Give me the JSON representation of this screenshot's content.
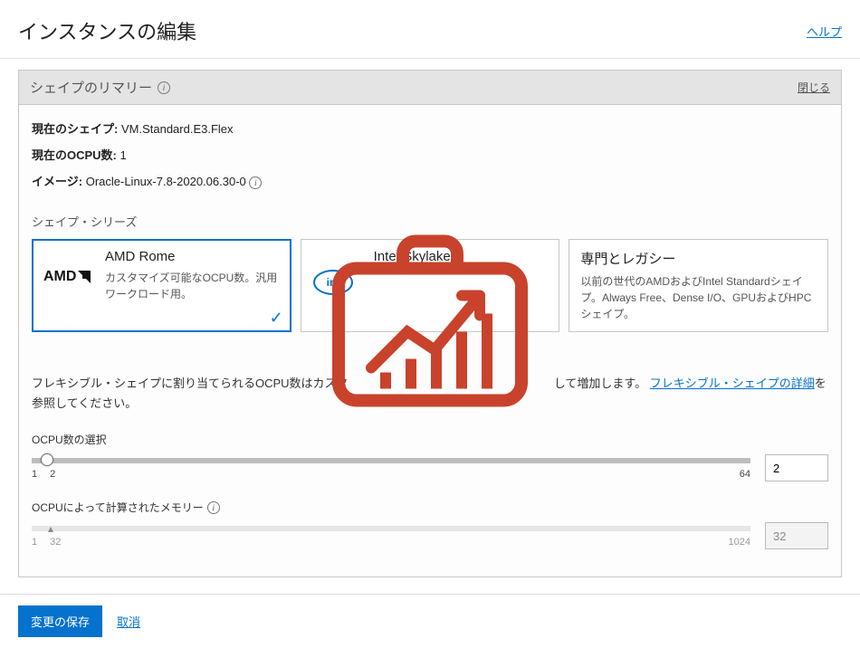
{
  "header": {
    "title": "インスタンスの編集",
    "help": "ヘルプ"
  },
  "panel": {
    "title": "シェイプのリマリー",
    "close": "閉じる"
  },
  "summary": {
    "shape_label": "現在のシェイプ:",
    "shape_value": "VM.Standard.E3.Flex",
    "ocpu_label": "現在のOCPU数:",
    "ocpu_value": "1",
    "image_label": "イメージ:",
    "image_value": "Oracle-Linux-7.8-2020.06.30-0"
  },
  "series_label": "シェイプ・シリーズ",
  "cards": [
    {
      "title": "AMD Rome",
      "desc": "カスタマイズ可能なOCPU数。汎用ワークロード用。"
    },
    {
      "title": "Intel Skylake",
      "desc": ""
    },
    {
      "title": "専門とレガシー",
      "desc": "以前の世代のAMDおよびIntel Standardシェイプ。Always Free、Dense I/O、GPUおよびHPCシェイプ。"
    }
  ],
  "flex_note": {
    "prefix": "フレキシブル・シェイプに割り当てられるOCPU数はカスタ",
    "middle": "して増加します。",
    "link": "フレキシブル・シェイプの詳細",
    "suffix": "を参照してください。"
  },
  "sliders": {
    "ocpu": {
      "label": "OCPU数の選択",
      "min": "1",
      "near": "2",
      "max": "64",
      "value": "2"
    },
    "memory": {
      "label": "OCPUによって計算されたメモリー",
      "min": "1",
      "near": "32",
      "max": "1024",
      "value": "32"
    }
  },
  "footer": {
    "save": "変更の保存",
    "cancel": "取消"
  }
}
